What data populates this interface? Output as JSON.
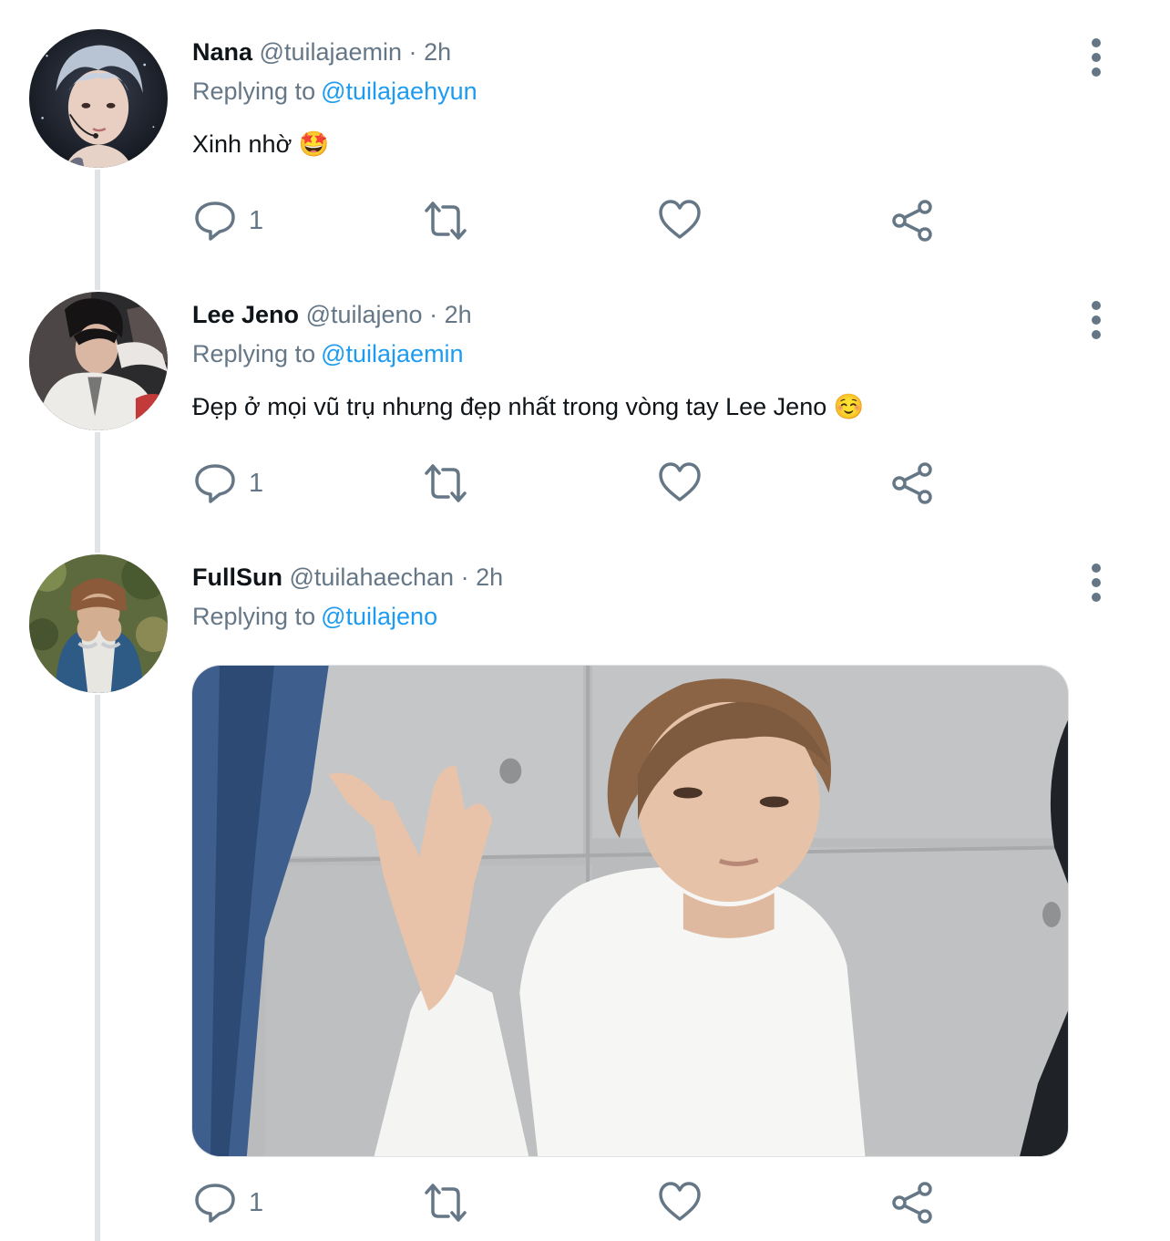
{
  "tweets": [
    {
      "name": "Nana",
      "handle": "@tuilajaemin",
      "separator": "·",
      "time": "2h",
      "replying_prefix": "Replying to",
      "replying_to": "@tuilajaehyun",
      "text": "Xinh nhờ 🤩",
      "actions": {
        "reply_count": "1"
      }
    },
    {
      "name": "Lee Jeno",
      "handle": "@tuilajeno",
      "separator": "·",
      "time": "2h",
      "replying_prefix": "Replying to",
      "replying_to": "@tuilajaemin",
      "text": "Đẹp ở mọi vũ trụ nhưng đẹp nhất trong vòng tay Lee Jeno ☺️",
      "actions": {
        "reply_count": "1"
      }
    },
    {
      "name": "FullSun",
      "handle": "@tuilahaechan",
      "separator": "·",
      "time": "2h",
      "replying_prefix": "Replying to",
      "replying_to": "@tuilajeno",
      "media": "photo",
      "actions": {
        "reply_count": "1"
      }
    }
  ],
  "icons": {
    "reply": "reply-icon",
    "retweet": "retweet-icon",
    "like": "heart-icon",
    "share": "share-icon",
    "more": "more-options-icon"
  },
  "colors": {
    "text": "#0f1419",
    "secondary": "#657786",
    "mention": "#1d9bf0",
    "thread_line": "#e1e4e7"
  }
}
